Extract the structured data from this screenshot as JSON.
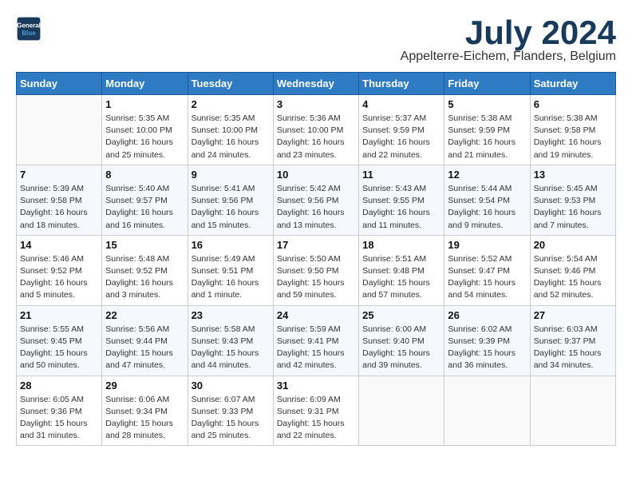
{
  "logo": {
    "line1": "General",
    "line2": "Blue"
  },
  "title": "July 2024",
  "location": "Appelterre-Eichem, Flanders, Belgium",
  "days_header": [
    "Sunday",
    "Monday",
    "Tuesday",
    "Wednesday",
    "Thursday",
    "Friday",
    "Saturday"
  ],
  "weeks": [
    [
      {
        "num": "",
        "info": ""
      },
      {
        "num": "1",
        "info": "Sunrise: 5:35 AM\nSunset: 10:00 PM\nDaylight: 16 hours\nand 25 minutes."
      },
      {
        "num": "2",
        "info": "Sunrise: 5:35 AM\nSunset: 10:00 PM\nDaylight: 16 hours\nand 24 minutes."
      },
      {
        "num": "3",
        "info": "Sunrise: 5:36 AM\nSunset: 10:00 PM\nDaylight: 16 hours\nand 23 minutes."
      },
      {
        "num": "4",
        "info": "Sunrise: 5:37 AM\nSunset: 9:59 PM\nDaylight: 16 hours\nand 22 minutes."
      },
      {
        "num": "5",
        "info": "Sunrise: 5:38 AM\nSunset: 9:59 PM\nDaylight: 16 hours\nand 21 minutes."
      },
      {
        "num": "6",
        "info": "Sunrise: 5:38 AM\nSunset: 9:58 PM\nDaylight: 16 hours\nand 19 minutes."
      }
    ],
    [
      {
        "num": "7",
        "info": "Sunrise: 5:39 AM\nSunset: 9:58 PM\nDaylight: 16 hours\nand 18 minutes."
      },
      {
        "num": "8",
        "info": "Sunrise: 5:40 AM\nSunset: 9:57 PM\nDaylight: 16 hours\nand 16 minutes."
      },
      {
        "num": "9",
        "info": "Sunrise: 5:41 AM\nSunset: 9:56 PM\nDaylight: 16 hours\nand 15 minutes."
      },
      {
        "num": "10",
        "info": "Sunrise: 5:42 AM\nSunset: 9:56 PM\nDaylight: 16 hours\nand 13 minutes."
      },
      {
        "num": "11",
        "info": "Sunrise: 5:43 AM\nSunset: 9:55 PM\nDaylight: 16 hours\nand 11 minutes."
      },
      {
        "num": "12",
        "info": "Sunrise: 5:44 AM\nSunset: 9:54 PM\nDaylight: 16 hours\nand 9 minutes."
      },
      {
        "num": "13",
        "info": "Sunrise: 5:45 AM\nSunset: 9:53 PM\nDaylight: 16 hours\nand 7 minutes."
      }
    ],
    [
      {
        "num": "14",
        "info": "Sunrise: 5:46 AM\nSunset: 9:52 PM\nDaylight: 16 hours\nand 5 minutes."
      },
      {
        "num": "15",
        "info": "Sunrise: 5:48 AM\nSunset: 9:52 PM\nDaylight: 16 hours\nand 3 minutes."
      },
      {
        "num": "16",
        "info": "Sunrise: 5:49 AM\nSunset: 9:51 PM\nDaylight: 16 hours\nand 1 minute."
      },
      {
        "num": "17",
        "info": "Sunrise: 5:50 AM\nSunset: 9:50 PM\nDaylight: 15 hours\nand 59 minutes."
      },
      {
        "num": "18",
        "info": "Sunrise: 5:51 AM\nSunset: 9:48 PM\nDaylight: 15 hours\nand 57 minutes."
      },
      {
        "num": "19",
        "info": "Sunrise: 5:52 AM\nSunset: 9:47 PM\nDaylight: 15 hours\nand 54 minutes."
      },
      {
        "num": "20",
        "info": "Sunrise: 5:54 AM\nSunset: 9:46 PM\nDaylight: 15 hours\nand 52 minutes."
      }
    ],
    [
      {
        "num": "21",
        "info": "Sunrise: 5:55 AM\nSunset: 9:45 PM\nDaylight: 15 hours\nand 50 minutes."
      },
      {
        "num": "22",
        "info": "Sunrise: 5:56 AM\nSunset: 9:44 PM\nDaylight: 15 hours\nand 47 minutes."
      },
      {
        "num": "23",
        "info": "Sunrise: 5:58 AM\nSunset: 9:43 PM\nDaylight: 15 hours\nand 44 minutes."
      },
      {
        "num": "24",
        "info": "Sunrise: 5:59 AM\nSunset: 9:41 PM\nDaylight: 15 hours\nand 42 minutes."
      },
      {
        "num": "25",
        "info": "Sunrise: 6:00 AM\nSunset: 9:40 PM\nDaylight: 15 hours\nand 39 minutes."
      },
      {
        "num": "26",
        "info": "Sunrise: 6:02 AM\nSunset: 9:39 PM\nDaylight: 15 hours\nand 36 minutes."
      },
      {
        "num": "27",
        "info": "Sunrise: 6:03 AM\nSunset: 9:37 PM\nDaylight: 15 hours\nand 34 minutes."
      }
    ],
    [
      {
        "num": "28",
        "info": "Sunrise: 6:05 AM\nSunset: 9:36 PM\nDaylight: 15 hours\nand 31 minutes."
      },
      {
        "num": "29",
        "info": "Sunrise: 6:06 AM\nSunset: 9:34 PM\nDaylight: 15 hours\nand 28 minutes."
      },
      {
        "num": "30",
        "info": "Sunrise: 6:07 AM\nSunset: 9:33 PM\nDaylight: 15 hours\nand 25 minutes."
      },
      {
        "num": "31",
        "info": "Sunrise: 6:09 AM\nSunset: 9:31 PM\nDaylight: 15 hours\nand 22 minutes."
      },
      {
        "num": "",
        "info": ""
      },
      {
        "num": "",
        "info": ""
      },
      {
        "num": "",
        "info": ""
      }
    ]
  ]
}
